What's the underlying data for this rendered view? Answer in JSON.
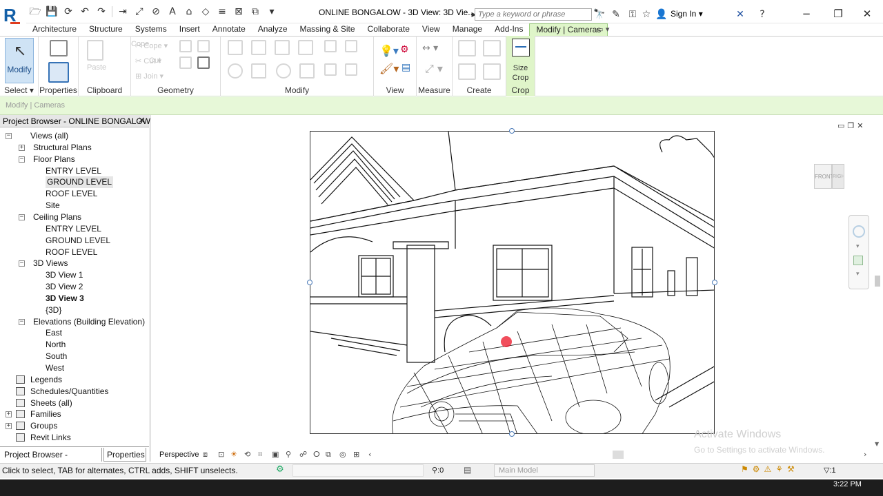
{
  "app": {
    "logo": "R",
    "document_title": "ONLINE BONGALOW - 3D View: 3D Vie...",
    "search_placeholder": "Type a keyword or phrase",
    "sign_in": "Sign In"
  },
  "tabs": [
    "Architecture",
    "Structure",
    "Systems",
    "Insert",
    "Annotate",
    "Analyze",
    "Massing & Site",
    "Collaborate",
    "View",
    "Manage",
    "Add-Ins",
    "Modify | Cameras"
  ],
  "active_tab": "Modify | Cameras",
  "ribbon": {
    "select": {
      "label": "Select",
      "button": "Modify"
    },
    "properties": {
      "label": "Properties"
    },
    "clipboard": {
      "label": "Clipboard",
      "paste": "Paste",
      "copy": "Cope",
      "cut": "Cut",
      "join": "Join"
    },
    "geometry": {
      "label": "Geometry"
    },
    "modify": {
      "label": "Modify"
    },
    "view": {
      "label": "View"
    },
    "measure": {
      "label": "Measure"
    },
    "create": {
      "label": "Create"
    },
    "crop": {
      "label": "Crop",
      "button_line1": "Size",
      "button_line2": "Crop"
    }
  },
  "context_label": "Modify | Cameras",
  "project_browser": {
    "title": "Project Browser - ONLINE BONGALOW",
    "tree": [
      {
        "label": "Views (all)",
        "level": 0,
        "exp": "−"
      },
      {
        "label": "Structural Plans",
        "level": 1,
        "exp": "+"
      },
      {
        "label": "Floor Plans",
        "level": 1,
        "exp": "−"
      },
      {
        "label": "ENTRY LEVEL",
        "level": 2
      },
      {
        "label": "GROUND LEVEL",
        "level": 2,
        "selected": true
      },
      {
        "label": "ROOF LEVEL",
        "level": 2
      },
      {
        "label": "Site",
        "level": 2
      },
      {
        "label": "Ceiling Plans",
        "level": 1,
        "exp": "−"
      },
      {
        "label": "ENTRY LEVEL",
        "level": 2
      },
      {
        "label": "GROUND LEVEL",
        "level": 2
      },
      {
        "label": "ROOF LEVEL",
        "level": 2
      },
      {
        "label": "3D Views",
        "level": 1,
        "exp": "−"
      },
      {
        "label": "3D View 1",
        "level": 2
      },
      {
        "label": "3D View 2",
        "level": 2
      },
      {
        "label": "3D View 3",
        "level": 2,
        "bold": true
      },
      {
        "label": "{3D}",
        "level": 2
      },
      {
        "label": "Elevations (Building Elevation)",
        "level": 1,
        "exp": "−"
      },
      {
        "label": "East",
        "level": 2
      },
      {
        "label": "North",
        "level": 2
      },
      {
        "label": "South",
        "level": 2
      },
      {
        "label": "West",
        "level": 2
      },
      {
        "label": "Legends",
        "level": 0
      },
      {
        "label": "Schedules/Quantities",
        "level": 0
      },
      {
        "label": "Sheets (all)",
        "level": 0
      },
      {
        "label": "Families",
        "level": 0,
        "exp": "+"
      },
      {
        "label": "Groups",
        "level": 0,
        "exp": "+"
      },
      {
        "label": "Revit Links",
        "level": 0
      }
    ],
    "bottom_tabs": [
      "Project Browser - ONLINE B...",
      "Properties"
    ]
  },
  "view": {
    "mode": "Perspective",
    "viewcube_front": "FRONT",
    "viewcube_right": "RIGHT"
  },
  "watermark": {
    "line1": "Activate Windows",
    "line2": "Go to Settings to activate Windows."
  },
  "status": {
    "text": "Click to select, TAB for alternates, CTRL adds, SHIFT unselects.",
    "zero": ":0",
    "model": "Main Model",
    "filter": ":1"
  },
  "clock": "3:22 PM"
}
